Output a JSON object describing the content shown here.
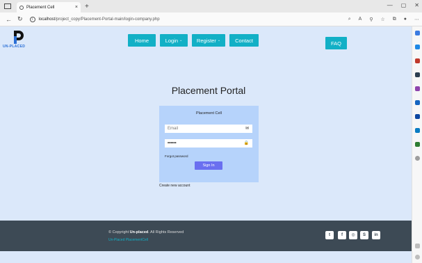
{
  "browser": {
    "tab_title": "Placement Cell",
    "tab_close": "×",
    "new_tab": "+",
    "url_host": "localhost",
    "url_path": "/project_copy/Placement-Portal-main/login-company.php"
  },
  "site": {
    "logo_text": "UN-PLACED",
    "nav": {
      "home": "Home",
      "login": "Login",
      "register": "Register",
      "contact": "Contact",
      "faq": "FAQ"
    },
    "title": "Placement Portal",
    "form": {
      "heading": "Placement Cell",
      "email_placeholder": "Email",
      "password_value": "••••••",
      "forgot": "Forgot password",
      "signin": "Sign In",
      "create": "Create new account"
    },
    "footer": {
      "copyright_prefix": "© Copyright ",
      "brand": "Un-placed",
      "copyright_suffix": ". All Rights Reserved",
      "link": "Un-Placed PlacementCell"
    },
    "social_icons": [
      "twitter-icon",
      "facebook-icon",
      "instagram-icon",
      "skype-icon",
      "linkedin-icon"
    ],
    "social_glyphs": [
      "t",
      "f",
      "◎",
      "S",
      "in"
    ]
  },
  "colors": {
    "page_bg": "#dbe8fa",
    "nav_bg": "#12b0c6",
    "card_bg": "#b6d3fb",
    "signin_bg": "#6a6ff0",
    "footer_bg": "#3d4a55"
  }
}
